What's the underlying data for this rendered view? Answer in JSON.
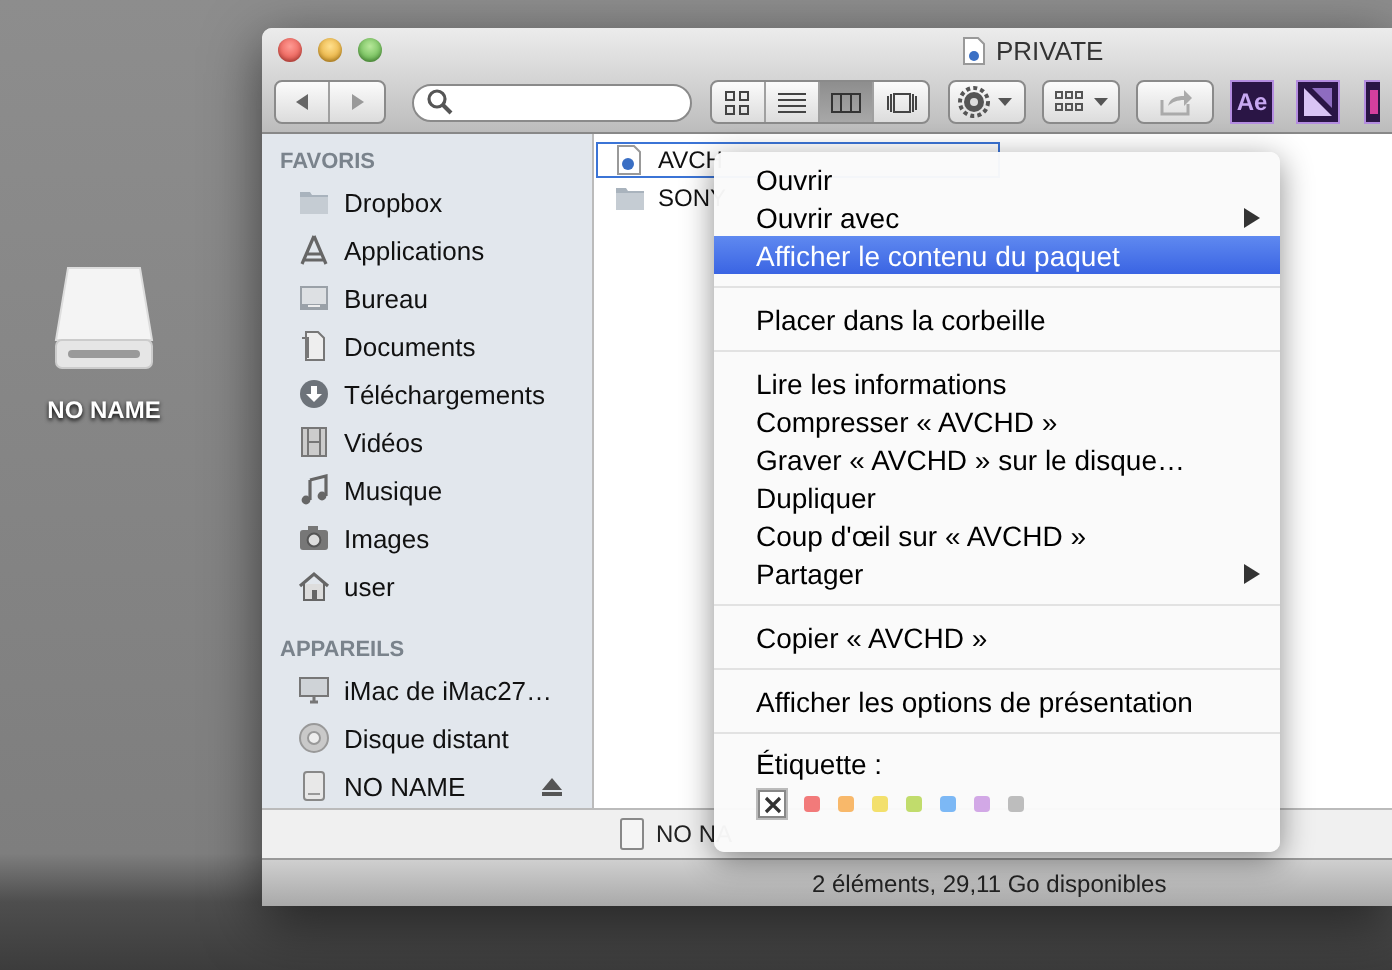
{
  "desktop_icon": {
    "label": "NO NAME"
  },
  "window": {
    "title": "PRIVATE"
  },
  "toolbar": {
    "views": [
      {
        "kind": "icons",
        "selected": false
      },
      {
        "kind": "list",
        "selected": false
      },
      {
        "kind": "columns",
        "selected": true
      },
      {
        "kind": "coverflow",
        "selected": false
      }
    ],
    "apps": [
      {
        "kind": "ae",
        "label": "Ae"
      },
      {
        "kind": "encoder"
      },
      {
        "kind": "partial"
      }
    ]
  },
  "sidebar": {
    "sections": [
      {
        "title": "FAVORIS",
        "items": [
          {
            "kind": "folder",
            "label": "Dropbox"
          },
          {
            "kind": "apps",
            "label": "Applications"
          },
          {
            "kind": "desktop",
            "label": "Bureau"
          },
          {
            "kind": "documents",
            "label": "Documents"
          },
          {
            "kind": "download",
            "label": "Téléchargements"
          },
          {
            "kind": "film",
            "label": "Vidéos"
          },
          {
            "kind": "music",
            "label": "Musique"
          },
          {
            "kind": "camera",
            "label": "Images"
          },
          {
            "kind": "home",
            "label": "user"
          }
        ]
      },
      {
        "title": "APPAREILS",
        "items": [
          {
            "kind": "monitor",
            "label": "iMac de iMac27…"
          },
          {
            "kind": "disc",
            "label": "Disque distant"
          },
          {
            "kind": "drive",
            "label": "NO NAME",
            "eject": true
          }
        ]
      }
    ]
  },
  "files": [
    {
      "kind": "package",
      "label": "AVCH",
      "selected": true
    },
    {
      "kind": "folder",
      "label": "SONY",
      "selected": false
    }
  ],
  "path_bar": {
    "label": "NO NA"
  },
  "status_bar": "2 éléments, 29,11 Go disponibles",
  "context_menu": {
    "groups": [
      {
        "items": [
          {
            "label": "Ouvrir",
            "submenu": false,
            "selected": false
          },
          {
            "label": "Ouvrir avec",
            "submenu": true,
            "selected": false
          },
          {
            "label": "Afficher le contenu du paquet",
            "submenu": false,
            "selected": true
          }
        ]
      },
      {
        "items": [
          {
            "label": "Placer dans la corbeille",
            "submenu": false,
            "selected": false
          }
        ]
      },
      {
        "items": [
          {
            "label": "Lire les informations",
            "submenu": false,
            "selected": false
          },
          {
            "label": "Compresser « AVCHD »",
            "submenu": false,
            "selected": false
          },
          {
            "label": "Graver « AVCHD » sur le disque…",
            "submenu": false,
            "selected": false
          },
          {
            "label": "Dupliquer",
            "submenu": false,
            "selected": false
          },
          {
            "label": "Coup d'œil sur « AVCHD »",
            "submenu": false,
            "selected": false
          },
          {
            "label": "Partager",
            "submenu": true,
            "selected": false
          }
        ]
      },
      {
        "items": [
          {
            "label": "Copier « AVCHD »",
            "submenu": false,
            "selected": false
          }
        ]
      },
      {
        "items": [
          {
            "label": "Afficher les options de présentation",
            "submenu": false,
            "selected": false
          }
        ]
      }
    ],
    "labels": {
      "title": "Étiquette :",
      "swatches": [
        {
          "kind": "none",
          "selected": true
        },
        {
          "kind": "color",
          "color": "#f27a7a",
          "selected": false
        },
        {
          "kind": "color",
          "color": "#f8b86a",
          "selected": false
        },
        {
          "kind": "color",
          "color": "#f3e06c",
          "selected": false
        },
        {
          "kind": "color",
          "color": "#c1dc6c",
          "selected": false
        },
        {
          "kind": "color",
          "color": "#7cb8f5",
          "selected": false
        },
        {
          "kind": "color",
          "color": "#d2a8e6",
          "selected": false
        },
        {
          "kind": "color",
          "color": "#bdbdbd",
          "selected": false
        }
      ]
    }
  }
}
